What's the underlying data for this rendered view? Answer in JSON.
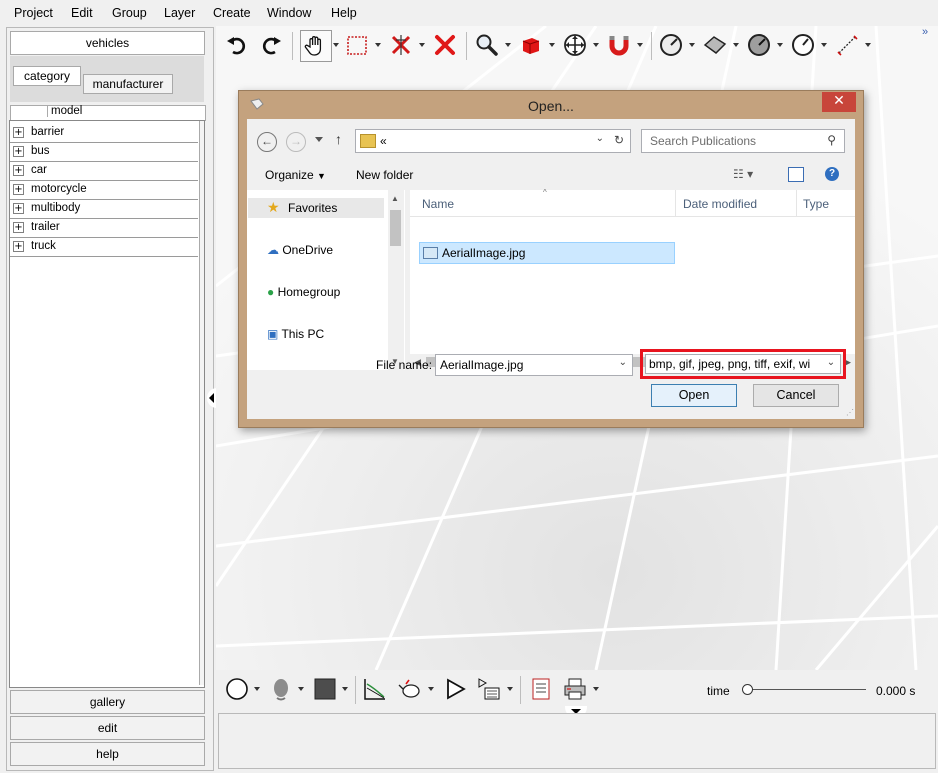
{
  "menu": [
    "Project",
    "Edit",
    "Group",
    "Layer",
    "Create",
    "Window",
    "Help"
  ],
  "left_panel": {
    "top_tab": "vehicles",
    "sub_tabs": [
      "category",
      "manufacturer"
    ],
    "column_header": "model",
    "tree_items": [
      "barrier",
      "bus",
      "car",
      "motorcycle",
      "multibody",
      "trailer",
      "truck"
    ],
    "bottom_tabs": [
      "gallery",
      "edit",
      "help"
    ]
  },
  "toolbar_icons": [
    "undo-icon",
    "redo-icon",
    "hand-icon",
    "select-rect-icon",
    "delete-vertex-icon",
    "delete-icon",
    "zoom-icon",
    "cube-icon",
    "move-icon",
    "magnet-icon",
    "measure-circle-icon",
    "surface-icon",
    "angle-icon",
    "gauge-icon",
    "ruler-icon"
  ],
  "dialog": {
    "title": "Open...",
    "address": "«",
    "search_placeholder": "Search Publications",
    "organize": "Organize",
    "new_folder": "New folder",
    "nav": [
      "Favorites",
      "OneDrive",
      "Homegroup",
      "This PC"
    ],
    "columns": [
      "Name",
      "Date modified",
      "Type"
    ],
    "files": [
      "AerialImage.jpg"
    ],
    "file_name_label": "File name:",
    "file_name_value": "AerialImage.jpg",
    "file_type": "bmp, gif, jpeg, png, tiff, exif, wi",
    "open_label": "Open",
    "cancel_label": "Cancel",
    "highlight_color": "#e8141f"
  },
  "bottom": {
    "time_label": "time",
    "time_value": "0.000 s",
    "time_slider_fraction": 0
  }
}
